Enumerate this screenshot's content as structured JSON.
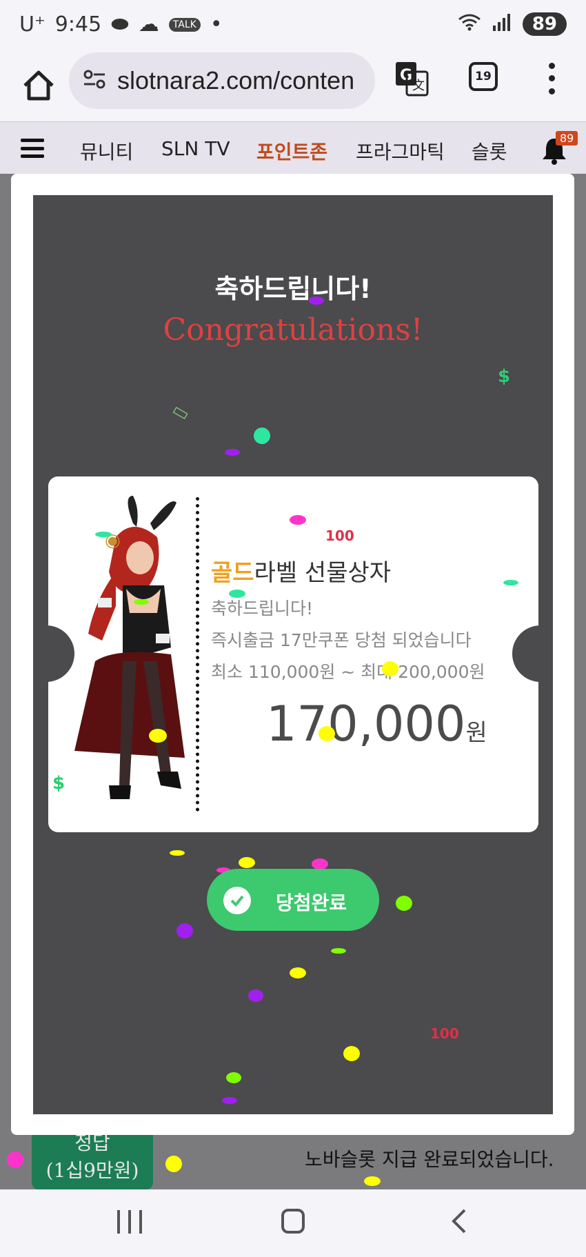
{
  "status_bar": {
    "carrier": "U⁺",
    "time": "9:45",
    "battery": "89"
  },
  "browser": {
    "url": "slotnara2.com/conten",
    "tab_count": "19"
  },
  "site_nav": {
    "items": [
      "뮤니티",
      "SLN TV",
      "포인트존",
      "프라그마틱",
      "슬롯"
    ],
    "active_index": 2,
    "notification_count": "89"
  },
  "background_page": {
    "badge_line1": "정답",
    "badge_line2": "(1십9만원)",
    "text": "노바슬롯 지급 완료되었습니다."
  },
  "modal": {
    "title_ko": "축하드립니다!",
    "title_en": "Congratulations!",
    "coupon": {
      "label_gold": "골드",
      "label_rest": "라벨 선물상자",
      "line1": "축하드립니다!",
      "line2": "즉시출금 17만쿠폰 당첨 되었습니다",
      "line3": "최소 110,000원 ~ 최대 200,000원",
      "amount": "170,000",
      "unit": "원"
    },
    "button_label": "당첨완료"
  },
  "colors": {
    "accent_active_nav": "#c24a1c",
    "gold": "#f0a020",
    "congrats_red": "#e04040",
    "button_green": "#3dc96e",
    "overlay_panel": "#4b4a4d"
  }
}
